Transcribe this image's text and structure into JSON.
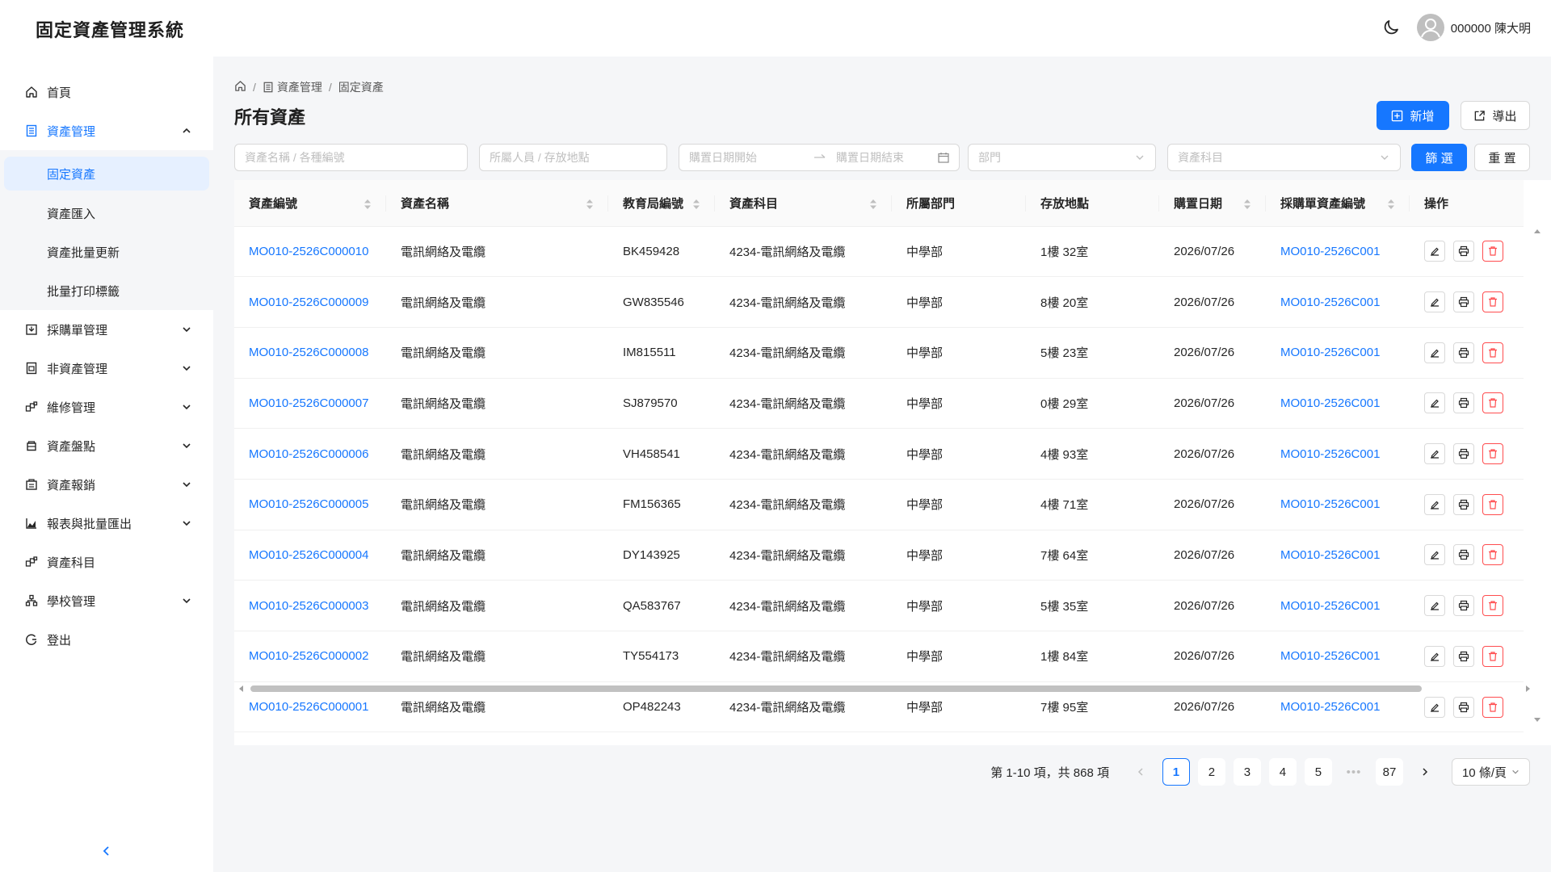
{
  "app": {
    "title": "固定資產管理系統",
    "user": "000000 陳大明"
  },
  "sidebar": {
    "items": [
      {
        "label": "首頁",
        "icon": "home-icon"
      },
      {
        "label": "資產管理",
        "icon": "list-icon",
        "expanded": true,
        "children": [
          "固定資產",
          "資產匯入",
          "資產批量更新",
          "批量打印標籤"
        ],
        "selected": "固定資產"
      },
      {
        "label": "採購單管理",
        "icon": "purchase-icon"
      },
      {
        "label": "非資產管理",
        "icon": "file-icon"
      },
      {
        "label": "維修管理",
        "icon": "repair-icon"
      },
      {
        "label": "資產盤點",
        "icon": "inventory-icon"
      },
      {
        "label": "資產報銷",
        "icon": "writeoff-icon"
      },
      {
        "label": "報表與批量匯出",
        "icon": "chart-icon"
      },
      {
        "label": "資產科目",
        "icon": "category-icon"
      },
      {
        "label": "學校管理",
        "icon": "school-icon"
      },
      {
        "label": "登出",
        "icon": "logout-icon"
      }
    ]
  },
  "breadcrumb": {
    "items": [
      "資產管理",
      "固定資產"
    ]
  },
  "page": {
    "title": "所有資產"
  },
  "toolbar": {
    "add_label": "新增",
    "export_label": "導出",
    "filter_label": "篩 選",
    "reset_label": "重 置"
  },
  "filters": {
    "name_placeholder": "資產名稱 / 各種編號",
    "owner_placeholder": "所屬人員 / 存放地點",
    "date_start_placeholder": "購置日期開始",
    "date_end_placeholder": "購置日期結束",
    "dept_placeholder": "部門",
    "subject_placeholder": "資產科目"
  },
  "table": {
    "columns": [
      "資產編號",
      "資產名稱",
      "教育局編號",
      "資產科目",
      "所屬部門",
      "存放地點",
      "購置日期",
      "採購單資產編號",
      "操作"
    ],
    "rows": [
      [
        "MO010-2526C000010",
        "電訊網絡及電纜",
        "BK459428",
        "4234-電訊網絡及電纜",
        "中學部",
        "1樓 32室",
        "2026/07/26",
        "MO010-2526C001"
      ],
      [
        "MO010-2526C000009",
        "電訊網絡及電纜",
        "GW835546",
        "4234-電訊網絡及電纜",
        "中學部",
        "8樓 20室",
        "2026/07/26",
        "MO010-2526C001"
      ],
      [
        "MO010-2526C000008",
        "電訊網絡及電纜",
        "IM815511",
        "4234-電訊網絡及電纜",
        "中學部",
        "5樓 23室",
        "2026/07/26",
        "MO010-2526C001"
      ],
      [
        "MO010-2526C000007",
        "電訊網絡及電纜",
        "SJ879570",
        "4234-電訊網絡及電纜",
        "中學部",
        "0樓 29室",
        "2026/07/26",
        "MO010-2526C001"
      ],
      [
        "MO010-2526C000006",
        "電訊網絡及電纜",
        "VH458541",
        "4234-電訊網絡及電纜",
        "中學部",
        "4樓 93室",
        "2026/07/26",
        "MO010-2526C001"
      ],
      [
        "MO010-2526C000005",
        "電訊網絡及電纜",
        "FM156365",
        "4234-電訊網絡及電纜",
        "中學部",
        "4樓 71室",
        "2026/07/26",
        "MO010-2526C001"
      ],
      [
        "MO010-2526C000004",
        "電訊網絡及電纜",
        "DY143925",
        "4234-電訊網絡及電纜",
        "中學部",
        "7樓 64室",
        "2026/07/26",
        "MO010-2526C001"
      ],
      [
        "MO010-2526C000003",
        "電訊網絡及電纜",
        "QA583767",
        "4234-電訊網絡及電纜",
        "中學部",
        "5樓 35室",
        "2026/07/26",
        "MO010-2526C001"
      ],
      [
        "MO010-2526C000002",
        "電訊網絡及電纜",
        "TY554173",
        "4234-電訊網絡及電纜",
        "中學部",
        "1樓 84室",
        "2026/07/26",
        "MO010-2526C001"
      ],
      [
        "MO010-2526C000001",
        "電訊網絡及電纜",
        "OP482243",
        "4234-電訊網絡及電纜",
        "中學部",
        "7樓 95室",
        "2026/07/26",
        "MO010-2526C001"
      ]
    ]
  },
  "pagination": {
    "total_text": "第 1-10 項，共 868 項",
    "pages": [
      "1",
      "2",
      "3",
      "4",
      "5"
    ],
    "ellipsis": "•••",
    "last_page": "87",
    "current": "1",
    "page_size": "10 條/頁"
  },
  "colors": {
    "primary": "#1677ff",
    "danger": "#ff4d4f",
    "background": "#f5f6f8"
  }
}
